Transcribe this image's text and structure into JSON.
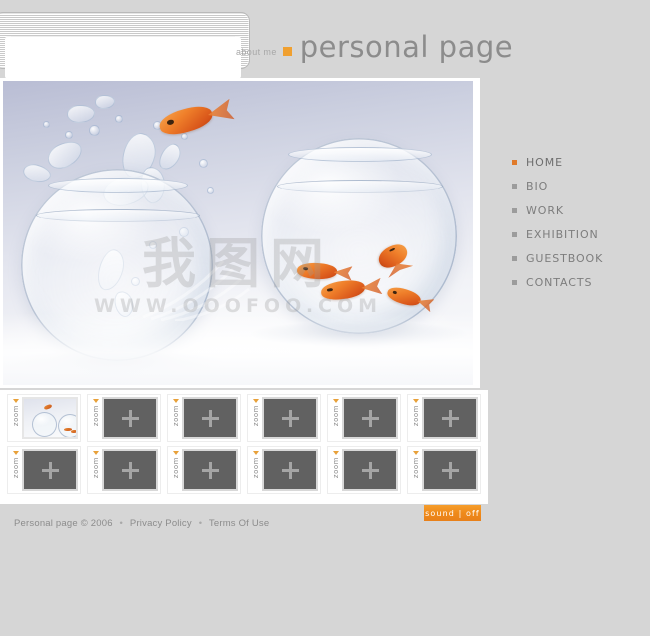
{
  "site": {
    "brand_about": "about me",
    "brand_title": "personal page"
  },
  "overlay_panel": {
    "name": "empty-rounded-panel",
    "content": ""
  },
  "nav": {
    "items": [
      {
        "label": "HOME",
        "active": true
      },
      {
        "label": "BIO",
        "active": false
      },
      {
        "label": "WORK",
        "active": false
      },
      {
        "label": "EXHIBITION",
        "active": false
      },
      {
        "label": "GUESTBOOK",
        "active": false
      },
      {
        "label": "CONTACTS",
        "active": false
      }
    ]
  },
  "stage": {
    "photo_alt": "two glass fishbowls, goldfish jumping from left bowl into right bowl",
    "watermark_cn": "我图网",
    "watermark_url": "WWW.OOOFOO.COM"
  },
  "thumbnails": {
    "zoom_label": "zoom",
    "rows": [
      [
        {
          "filled": true,
          "label": "zoom"
        },
        {
          "filled": false,
          "label": "zoom"
        },
        {
          "filled": false,
          "label": "zoom"
        },
        {
          "filled": false,
          "label": "zoom"
        },
        {
          "filled": false,
          "label": "zoom"
        },
        {
          "filled": false,
          "label": "zoom"
        }
      ],
      [
        {
          "filled": false,
          "label": "zoom"
        },
        {
          "filled": false,
          "label": "zoom"
        },
        {
          "filled": false,
          "label": "zoom"
        },
        {
          "filled": false,
          "label": "zoom"
        },
        {
          "filled": false,
          "label": "zoom"
        },
        {
          "filled": false,
          "label": "zoom"
        }
      ]
    ]
  },
  "footer": {
    "copyright": "Personal page © 2006",
    "link_privacy": "Privacy Policy",
    "link_terms": "Terms Of Use",
    "separator": "•",
    "sound_button": "sound | off"
  },
  "colors": {
    "page_background": "#d6d6d6",
    "content_background": "#ffffff",
    "accent_orange": "#ef8a1a",
    "brand_square_orange": "#f0a030",
    "nav_text": "#7d7d7d",
    "footer_text": "#8c8c8c",
    "thumb_placeholder": "#616161"
  }
}
